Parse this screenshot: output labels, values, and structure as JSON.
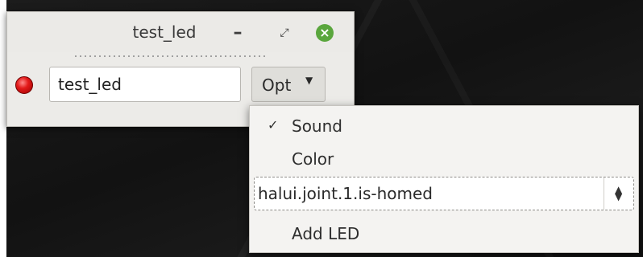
{
  "window": {
    "title": "test_led",
    "minimize_icon": "minimize-icon",
    "restore_icon": "restore-icon",
    "close_icon": "close-icon"
  },
  "led": {
    "color": "#e31a1a",
    "icon": "led-indicator-icon"
  },
  "name_input": {
    "value": "test_led"
  },
  "options_button": {
    "label": "Opt",
    "arrow_icon": "dropdown-arrow-icon"
  },
  "menu": {
    "items": [
      {
        "label": "Sound",
        "checked": true,
        "check_glyph": "✓"
      },
      {
        "label": "Color",
        "checked": false
      }
    ],
    "signal_select": {
      "value": "halui.joint.1.is-homed"
    },
    "add_led_label": "Add LED"
  },
  "colors": {
    "accent_close": "#5aa63d",
    "desktop": "#161616"
  }
}
